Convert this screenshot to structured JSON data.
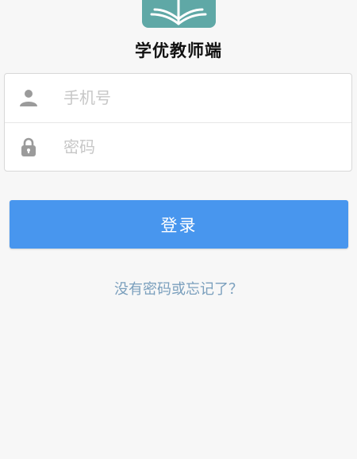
{
  "app": {
    "title": "学优教师端"
  },
  "login_form": {
    "phone": {
      "placeholder": "手机号",
      "value": "",
      "icon": "user-icon"
    },
    "password": {
      "placeholder": "密码",
      "value": "",
      "icon": "lock-icon"
    }
  },
  "actions": {
    "login_label": "登录",
    "forgot_label": "没有密码或忘记了？"
  },
  "colors": {
    "background": "#f7f7f7",
    "logo": "#5fa8a6",
    "primary_button": "#4896ee",
    "link": "#7a9fbd",
    "icon": "#9b9b9b",
    "placeholder": "#c7c7c7"
  }
}
